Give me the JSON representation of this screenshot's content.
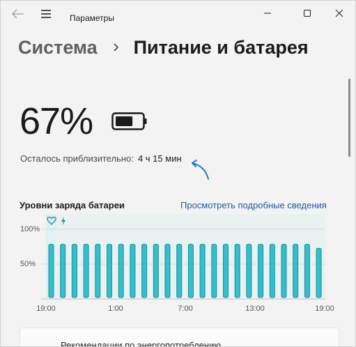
{
  "window": {
    "title": "Параметры"
  },
  "header": {
    "parent": "Система",
    "current": "Питание и батарея"
  },
  "battery": {
    "percent_text": "67%",
    "level": 0.67,
    "remaining_label": "Осталось приблизительно:",
    "remaining_value": "4 ч 15 мин"
  },
  "chart_section": {
    "title": "Уровни заряда батареи",
    "details_link": "Просмотреть подробные сведения"
  },
  "chart_data": {
    "type": "bar",
    "yticks": [
      "100%",
      "50%"
    ],
    "xticks": [
      "19:00",
      "1:00",
      "7:00",
      "13:00",
      "19:00"
    ],
    "ylim": [
      0,
      100
    ],
    "values": [
      78,
      78,
      78,
      78,
      78,
      78,
      78,
      78,
      78,
      78,
      78,
      78,
      78,
      78,
      78,
      78,
      78,
      78,
      78,
      78,
      78,
      78,
      78,
      72
    ],
    "colors": {
      "bar": "#33c0cc",
      "bar_stroke": "#178f9d",
      "plugged_band": "#dff1f3",
      "grid": "#d7d7d7"
    }
  },
  "card": {
    "label": "Рекомендации по энергопотреблению"
  },
  "colors": {
    "accent": "#1c5aa5",
    "annotation_arrow": "#2b78d0"
  }
}
